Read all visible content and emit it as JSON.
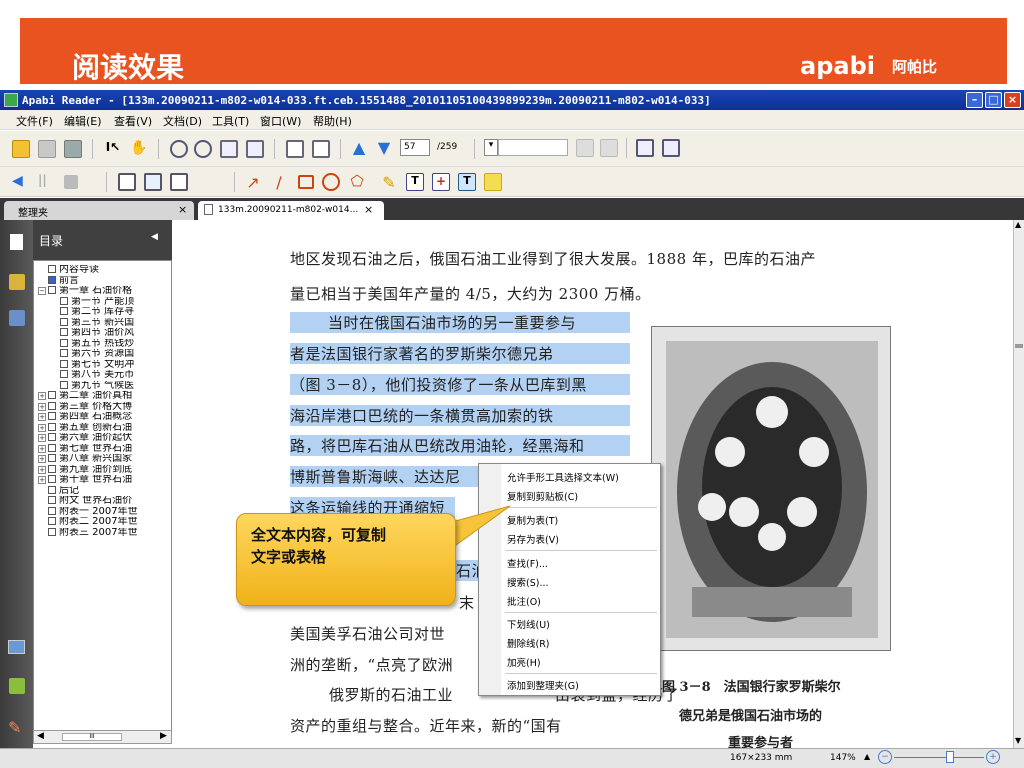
{
  "banner": {
    "title": "阅读效果",
    "brand": "apabi",
    "brand_cn": "阿帕比",
    "color": "#e8531f"
  },
  "window": {
    "title": "Apabi Reader - [133m.20090211-m802-w014-033.ft.ceb.1551488_20101105100439899239m.20090211-m802-w014-033]"
  },
  "menubar": {
    "items": [
      "文件(F)",
      "编辑(E)",
      "查看(V)",
      "文档(D)",
      "工具(T)",
      "窗口(W)",
      "帮助(H)"
    ]
  },
  "toolbar": {
    "page_current": "57",
    "page_total": "/259"
  },
  "tabs": [
    {
      "label": "整理夹"
    },
    {
      "label": "133m.20090211-m802-w014..."
    }
  ],
  "toc": {
    "title": "目录",
    "items": [
      {
        "label": "内容导读",
        "level": 1
      },
      {
        "label": "前言",
        "level": 1,
        "selected": true
      },
      {
        "label": "第一章 石油价格",
        "level": 1,
        "expander": "minus"
      },
      {
        "label": "第一节 产能顶",
        "level": 2
      },
      {
        "label": "第二节 库存寻",
        "level": 2
      },
      {
        "label": "第三节 新兴国",
        "level": 2
      },
      {
        "label": "第四节 油价风",
        "level": 2
      },
      {
        "label": "第五节 热钱炒",
        "level": 2
      },
      {
        "label": "第六节 资源国",
        "level": 2
      },
      {
        "label": "第七节 文明冲",
        "level": 2
      },
      {
        "label": "第八节 美元币",
        "level": 2
      },
      {
        "label": "第九节 气候医",
        "level": 2
      },
      {
        "label": "第二章 油价真相",
        "level": 1,
        "expander": "plus"
      },
      {
        "label": "第三章 价格大博",
        "level": 1,
        "expander": "plus"
      },
      {
        "label": "第四章 石油概念",
        "level": 1,
        "expander": "plus"
      },
      {
        "label": "第五章 创新石油",
        "level": 1,
        "expander": "plus"
      },
      {
        "label": "第六章 油价起伏",
        "level": 1,
        "expander": "plus"
      },
      {
        "label": "第七章 世界石油",
        "level": 1,
        "expander": "plus"
      },
      {
        "label": "第八章 新兴国家",
        "level": 1,
        "expander": "plus"
      },
      {
        "label": "第九章 油价到底",
        "level": 1,
        "expander": "plus"
      },
      {
        "label": "第十章 世界石油",
        "level": 1,
        "expander": "plus"
      },
      {
        "label": "后记",
        "level": 1
      },
      {
        "label": "附文 世界石油价",
        "level": 1
      },
      {
        "label": "附表一 2007年世",
        "level": 1
      },
      {
        "label": "附表二 2007年世",
        "level": 1
      },
      {
        "label": "附表三 2007年世",
        "level": 1
      }
    ]
  },
  "document": {
    "line1": "地区发现石油之后，俄国石油工业得到了很大发展。1888 年，巴库的石油产",
    "line2": "量已相当于美国年产量的 4/5，大约为 2300 万桶。",
    "hl1": "当时在俄国石油市场的另一重要参与",
    "hl2": "者是法国银行家著名的罗斯柴尔德兄弟",
    "hl3": "（图 3－8），他们投资修了一条从巴库到黑",
    "hl4": "海沿岸港口巴统的一条横贯高加索的铁",
    "hl5": "路，将巴库石油从巴统改用油轮，经黑海和",
    "hl6": "博斯普鲁斯海峡、达达尼",
    "hl7": "这条运输线的开通缩短",
    "frag1": "石油",
    "frag2": "末",
    "line_us": "美国美孚石油公司对世",
    "line_eu": "洲的垄断，“点亮了欧洲",
    "line_ru": "俄罗斯的石油工业",
    "line_ru_tail": "由衰到盛，经历了",
    "line_assets": "资产的重组与整合。近年来，新的“国有",
    "fig_caption": "图 3－8　法国银行家罗斯柴尔",
    "fig_caption2": "德兄弟是俄国石油市场的",
    "fig_caption3": "重要参与者"
  },
  "context_menu": {
    "items": [
      "允许手形工具选择文本(W)",
      "复制到剪贴板(C)",
      "复制为表(T)",
      "另存为表(V)",
      "查找(F)...",
      "搜索(S)...",
      "批注(O)",
      "下划线(U)",
      "删除线(R)",
      "加亮(H)",
      "添加到整理夹(G)"
    ]
  },
  "callout": {
    "line1": "全文本内容，可复制",
    "line2": "文字或表格"
  },
  "status": {
    "size": "167×233 mm",
    "zoom": "147%"
  }
}
